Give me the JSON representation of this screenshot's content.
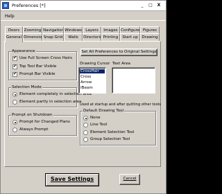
{
  "window": {
    "title": "Preferences [*]",
    "min": "_",
    "max": "□",
    "close": "X"
  },
  "menu": {
    "help": "Help"
  },
  "tabs_top": [
    "Doors",
    "Zooming",
    "Navigation",
    "Windows",
    "Layers",
    "Images",
    "Configure",
    "Figures"
  ],
  "tabs_bottom": [
    "General",
    "Dimensions",
    "Snap Grid",
    "Walls",
    "Directories",
    "Printing",
    "Start up",
    "Drawing"
  ],
  "appearance": {
    "label": "Appearance",
    "full_screen": "Use Full Screen Cross Hairs",
    "top_toolbar": "Top Tool Bar Visible",
    "prompt_bar": "Prompt Bar Visible"
  },
  "selection_mode": {
    "label": "Selection Mode",
    "completely": "Element completely in selection area",
    "partly": "Element partly in selection area"
  },
  "prompt_on_shutdown": {
    "label": "Prompt on Shutdown",
    "changed": "Prompt for Changed Plans",
    "always": "Always Prompt"
  },
  "reset_button": "Set All Preferences to Original Settings",
  "drawing_cursor": {
    "label": "Drawing Cursor",
    "items": [
      "CrossHair",
      "Cross",
      "Arrow",
      "IBeam"
    ],
    "selected": "CrossHair"
  },
  "text_area": {
    "label": "Text Area"
  },
  "startup_note": "Used at startup and after quitting other tools",
  "default_tool": {
    "label": "Default Drawing Tool",
    "none": "None",
    "line": "Line Tool",
    "element": "Element Selection Tool",
    "group": "Group Selection Tool"
  },
  "save_button": "Save Settings",
  "cancel_button": "Cancel"
}
